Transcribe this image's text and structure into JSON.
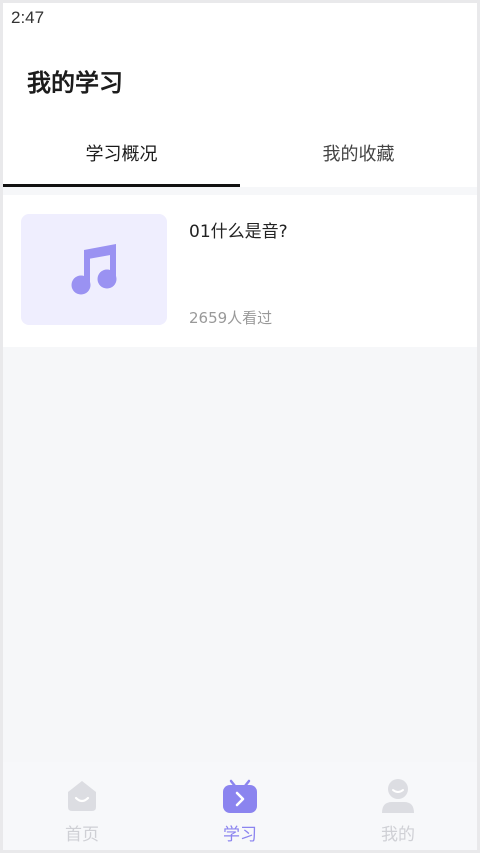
{
  "status_bar": {
    "time": "2:47"
  },
  "header": {
    "title": "我的学习"
  },
  "tabs": [
    {
      "label": "学习概况",
      "active": true
    },
    {
      "label": "我的收藏",
      "active": false
    }
  ],
  "courses": [
    {
      "title": "01什么是音?",
      "views": "2659人看过",
      "thumbnail_icon": "music-note-icon"
    }
  ],
  "bottom_nav": [
    {
      "label": "首页",
      "icon": "home-icon",
      "active": false
    },
    {
      "label": "学习",
      "icon": "study-icon",
      "active": true
    },
    {
      "label": "我的",
      "icon": "profile-icon",
      "active": false
    }
  ],
  "colors": {
    "accent": "#8b84ef",
    "thumb_bg": "#efeefe",
    "nav_inactive": "#cfd0d5",
    "page_bg": "#f6f7f9"
  }
}
